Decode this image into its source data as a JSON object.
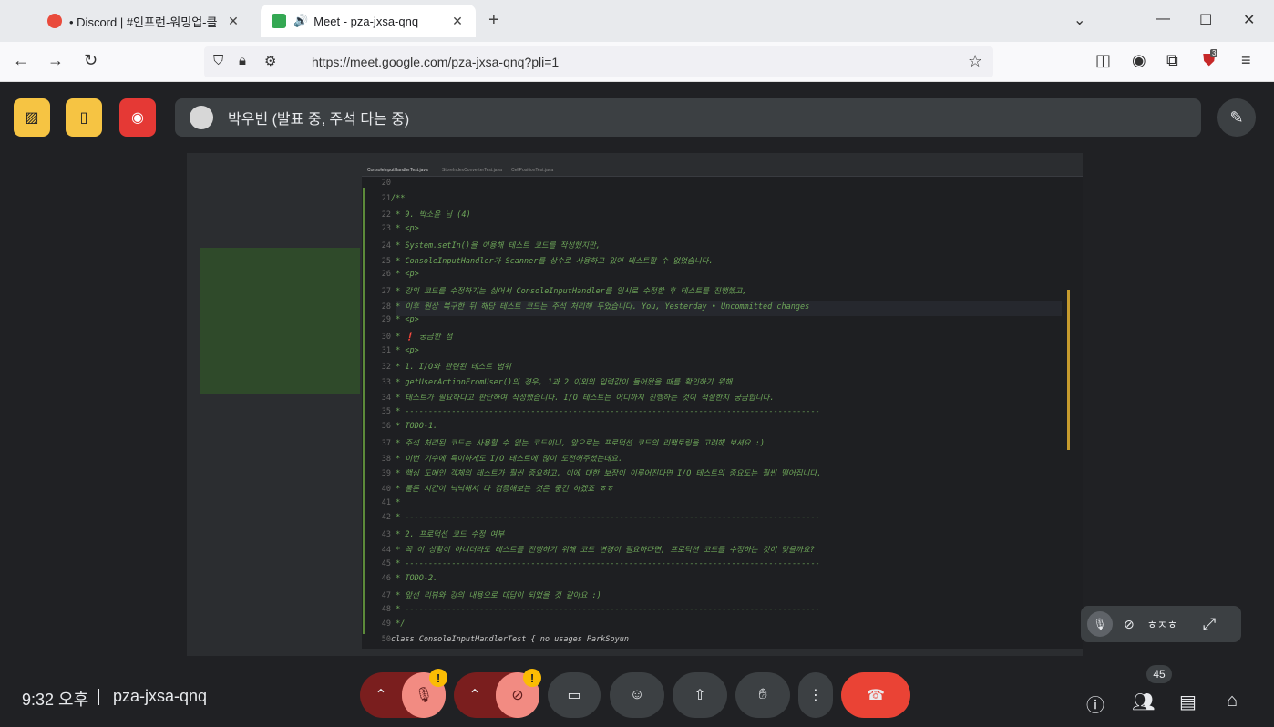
{
  "browser": {
    "tabs": [
      {
        "title": "• Discord | #인프런-워밍업-클",
        "close": "✕"
      },
      {
        "title": "Meet - pza-jxsa-qnq",
        "close": "✕"
      }
    ],
    "new_tab": "+",
    "url": "https://meet.google.com/pza-jxsa-qnq?pli=1",
    "extension_badge": "3"
  },
  "meet": {
    "presenter_label": "박우빈 (발표 중, 주석 다는 중)",
    "time": "9:32 오후",
    "meeting_code": "pza-jxsa-qnq",
    "participants_count": "45",
    "self_view_name": "ㅎㅈㅎ",
    "warning_symbol": "!",
    "colors": {
      "accent_yellow": "#f6c443",
      "record_red": "#e53935",
      "end_call": "#ea4335",
      "bg": "#202124"
    }
  },
  "ide": {
    "file_tabs": [
      "ConsoleInputHandlerTest.java",
      "StoreIndexConverterTest.java",
      "CellPositionTest.java"
    ],
    "code_lines": [
      {
        "n": "20",
        "t": "",
        "g": false
      },
      {
        "n": "21",
        "t": "/**",
        "g": true
      },
      {
        "n": "22",
        "t": " * 9. 박소윤 님 (4)",
        "g": true
      },
      {
        "n": "23",
        "t": " * <p>",
        "g": true
      },
      {
        "n": "24",
        "t": " * System.setIn()을 이용해 테스트 코드를 작성했지만,",
        "g": true
      },
      {
        "n": "25",
        "t": " * ConsoleInputHandler가 Scanner를 상수로 사용하고 있어 테스트할 수 없었습니다.",
        "g": true
      },
      {
        "n": "26",
        "t": " * <p>",
        "g": true
      },
      {
        "n": "27",
        "t": " * 강의 코드를 수정하기는 싫어서 ConsoleInputHandler를 임시로 수정한 후 테스트를 진행했고,",
        "g": true
      },
      {
        "n": "28",
        "t": " * 이후 원상 복구한 뒤 해당 테스트 코드는 주석 처리해 두었습니다.   You, Yesterday • Uncommitted changes",
        "g": true
      },
      {
        "n": "29",
        "t": " * <p>",
        "g": true
      },
      {
        "n": "30",
        "t": " * ❗ 궁금한 점",
        "g": true
      },
      {
        "n": "31",
        "t": " * <p>",
        "g": true
      },
      {
        "n": "32",
        "t": " * 1. I/O와 관련된 테스트 범위",
        "g": true
      },
      {
        "n": "33",
        "t": " * getUserActionFromUser()의 경우, 1과 2 이외의 입력값이 들어왔을 때를 확인하기 위해",
        "g": true
      },
      {
        "n": "34",
        "t": " * 테스트가 필요하다고 판단하여 작성했습니다. I/O 테스트는 어디까지 진행하는 것이 적절한지 궁금합니다.",
        "g": true
      },
      {
        "n": "35",
        "t": " * -----------------------------------------------------------------------------------------",
        "g": true
      },
      {
        "n": "36",
        "t": " * TODO-1.",
        "g": true
      },
      {
        "n": "37",
        "t": " * 주석 처리된 코드는 사용할 수 없는 코드이니, 앞으로는 프로덕션 코드의 리팩토링을 고려해 보셔요 :)",
        "g": true
      },
      {
        "n": "38",
        "t": " * 이번 기수에 특이하게도 I/O 테스트에 많이 도전해주셨는데요.",
        "g": true
      },
      {
        "n": "39",
        "t": " * 핵심 도메인 객체의 테스트가 훨씬 중요하고, 이에 대한 보장이 이루어진다면 I/O 테스트의 중요도는 훨씬 떨어집니다.",
        "g": true
      },
      {
        "n": "40",
        "t": " * 물론 시간이 넉넉해서 다 검증해보는 것은 좋긴 하겠죠 ㅎㅎ",
        "g": true
      },
      {
        "n": "41",
        "t": " *",
        "g": true
      },
      {
        "n": "42",
        "t": " * -----------------------------------------------------------------------------------------",
        "g": true
      },
      {
        "n": "43",
        "t": " * 2. 프로덕션 코드 수정 여부",
        "g": true
      },
      {
        "n": "44",
        "t": " * 꼭 이 상황이 아니더라도 테스트를 진행하기 위해 코드 변경이 필요하다면, 프로덕션 코드를 수정하는 것이 맞을까요?",
        "g": true
      },
      {
        "n": "45",
        "t": " * -----------------------------------------------------------------------------------------",
        "g": true
      },
      {
        "n": "46",
        "t": " * TODO-2.",
        "g": true
      },
      {
        "n": "47",
        "t": " * 앞선 리뷰와 강의 내용으로 대답이 되었을 것 같아요 :)",
        "g": true
      },
      {
        "n": "48",
        "t": " * -----------------------------------------------------------------------------------------",
        "g": true
      },
      {
        "n": "49",
        "t": " */",
        "g": true
      },
      {
        "n": "50",
        "t": "class ConsoleInputHandlerTest {  no usages  ParkSoyun",
        "g": false
      }
    ]
  }
}
